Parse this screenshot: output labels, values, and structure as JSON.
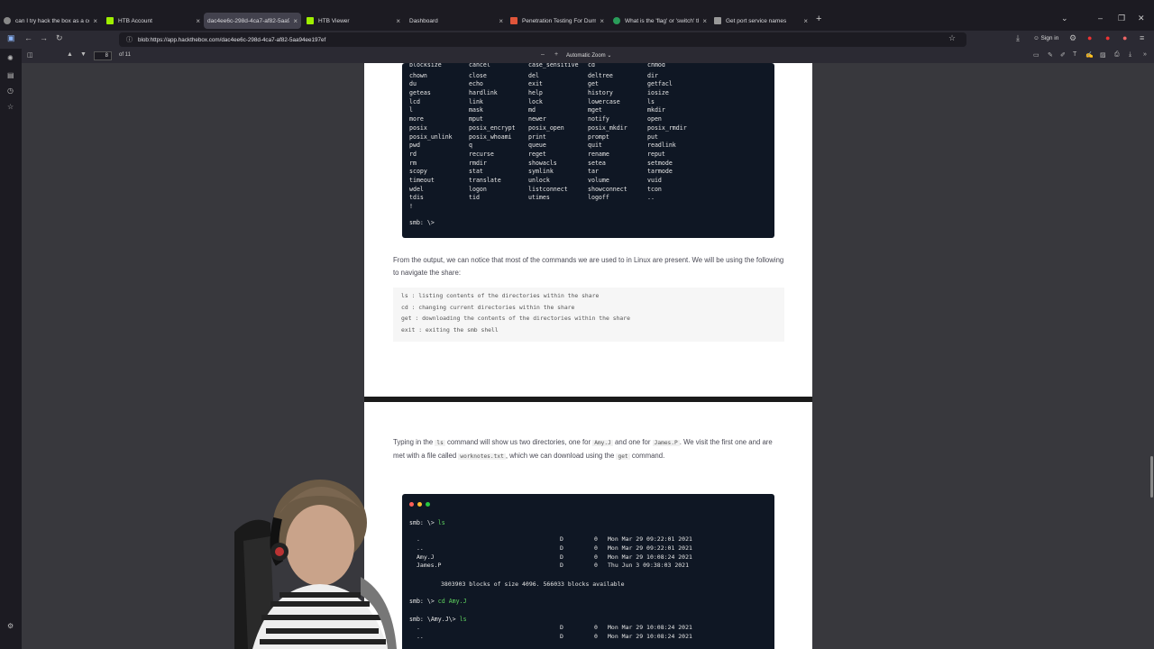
{
  "tabs": [
    {
      "label": "can I try hack the box as a comp",
      "color": "#888888"
    },
    {
      "label": "HTB Account",
      "color": "#9fef00"
    },
    {
      "label": "dac4ee6c-298d-4ca7-af82-5aa94ee",
      "color": "#888888"
    },
    {
      "label": "HTB Viewer",
      "color": "#9fef00"
    },
    {
      "label": "Dashboard",
      "color": "#555555"
    },
    {
      "label": "Penetration Testing For Dummi",
      "color": "#e0553a"
    },
    {
      "label": "What is the 'flag' or 'switch' the",
      "color": "#2a9d5a"
    },
    {
      "label": "Get port service names",
      "color": "#999999"
    }
  ],
  "active_tab": 2,
  "url": "blob:https://app.hackthebox.com/dac4ee6c-298d-4ca7-af82-5aa94ee197ef",
  "signin_label": "Sign in",
  "pdf": {
    "page": "8",
    "of": "of 11",
    "zoom": "Automatic Zoom"
  },
  "smb_commands": [
    [
      "blocksize",
      "cancel",
      "case_sensitive",
      "cd",
      "chmod"
    ],
    [
      "chown",
      "close",
      "del",
      "deltree",
      "dir"
    ],
    [
      "du",
      "echo",
      "exit",
      "get",
      "getfacl"
    ],
    [
      "geteas",
      "hardlink",
      "help",
      "history",
      "iosize"
    ],
    [
      "lcd",
      "link",
      "lock",
      "lowercase",
      "ls"
    ],
    [
      "l",
      "mask",
      "md",
      "mget",
      "mkdir"
    ],
    [
      "more",
      "mput",
      "newer",
      "notify",
      "open"
    ],
    [
      "posix",
      "posix_encrypt",
      "posix_open",
      "posix_mkdir",
      "posix_rmdir"
    ],
    [
      "posix_unlink",
      "posix_whoami",
      "print",
      "prompt",
      "put"
    ],
    [
      "pwd",
      "q",
      "queue",
      "quit",
      "readlink"
    ],
    [
      "rd",
      "recurse",
      "reget",
      "rename",
      "reput"
    ],
    [
      "rm",
      "rmdir",
      "showacls",
      "setea",
      "setmode"
    ],
    [
      "scopy",
      "stat",
      "symlink",
      "tar",
      "tarmode"
    ],
    [
      "timeout",
      "translate",
      "unlock",
      "volume",
      "vuid"
    ],
    [
      "wdel",
      "logon",
      "listconnect",
      "showconnect",
      "tcon"
    ],
    [
      "tdis",
      "tid",
      "utimes",
      "logoff",
      ".."
    ],
    [
      "!",
      "",
      "",
      "",
      ""
    ]
  ],
  "smb_prompt": "smb: \\>",
  "para1": "From the output, we can notice that most of the commands we are used to in Linux are present. We will be using the following to navigate the share:",
  "nav_cmds": [
    "ls : listing contents of the directories within the share",
    "cd : changing current directories within the share",
    "get : downloading the contents of the directories within the share",
    "exit : exiting the smb shell"
  ],
  "para2": {
    "t1": "Typing in the ",
    "c1": "ls",
    "t2": " command will show us two directories, one for ",
    "c2": "Amy.J",
    "t3": " and one for ",
    "c3": "James.P",
    "t4": ". We visit the first one and are met with a file called ",
    "c4": "worknotes.txt",
    "t5": ", which we can download using the ",
    "c5": "get",
    "t6": " command."
  },
  "term2": {
    "p1_prompt": "smb: \\>",
    "p1_cmd": "ls",
    "rows": [
      {
        "name": ".",
        "type": "D",
        "size": "0",
        "date": "Mon Mar 29 09:22:01 2021"
      },
      {
        "name": "..",
        "type": "D",
        "size": "0",
        "date": "Mon Mar 29 09:22:01 2021"
      },
      {
        "name": "Amy.J",
        "type": "D",
        "size": "0",
        "date": "Mon Mar 29 10:08:24 2021"
      },
      {
        "name": "James.P",
        "type": "D",
        "size": "0",
        "date": "Thu Jun  3 09:38:03 2021"
      }
    ],
    "blocks": "3803903 blocks of size 4096. 566033 blocks available",
    "p2_prompt": "smb: \\>",
    "p2_cmd": "cd Amy.J",
    "p3_prompt": "smb: \\Amy.J\\>",
    "p3_cmd": "ls",
    "rows2": [
      {
        "name": ".",
        "type": "D",
        "size": "0",
        "date": "Mon Mar 29 10:08:24 2021"
      },
      {
        "name": "..",
        "type": "D",
        "size": "0",
        "date": "Mon Mar 29 10:08:24 2021"
      }
    ]
  },
  "colors": {
    "terminal_bg": "#0f1724",
    "dot_red": "#ff5f57",
    "dot_yellow": "#febc2e",
    "dot_green": "#28c840",
    "prompt_green": "#5fd35f"
  }
}
